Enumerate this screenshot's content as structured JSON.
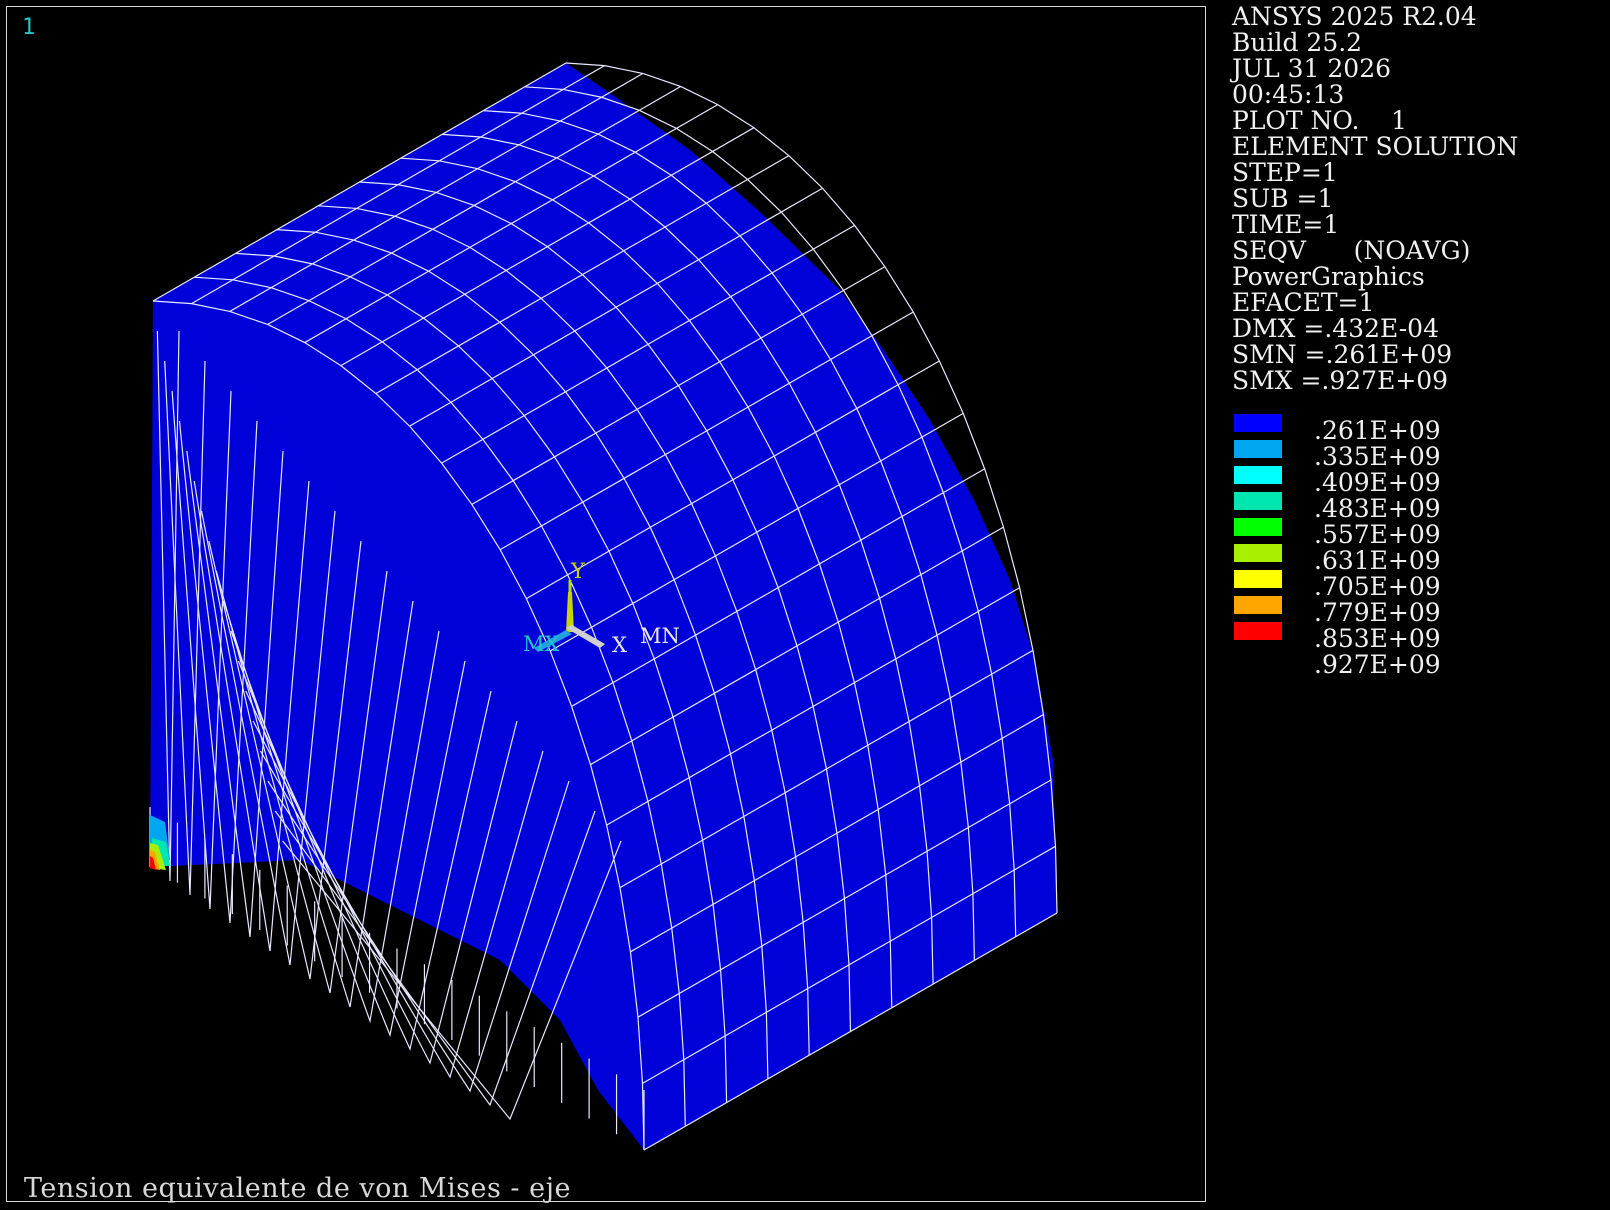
{
  "window_number": "1",
  "caption": "Tension equivalente de von Mises - eje",
  "info_lines": [
    "ANSYS 2025 R2.04",
    "Build 25.2",
    "JUL 31 2026",
    "00:45:13",
    "PLOT NO.    1",
    "ELEMENT SOLUTION",
    "STEP=1",
    "SUB =1",
    "TIME=1",
    "SEQV      (NOAVG)",
    "PowerGraphics",
    "EFACET=1",
    "DMX =.432E-04",
    "SMN =.261E+09",
    "SMX =.927E+09"
  ],
  "legend": [
    {
      "label": ".261E+09",
      "color": "#0000ff"
    },
    {
      "label": ".335E+09",
      "color": "#00a6f0"
    },
    {
      "label": ".409E+09",
      "color": "#00ffff"
    },
    {
      "label": ".483E+09",
      "color": "#00e6b0"
    },
    {
      "label": ".557E+09",
      "color": "#00ff00"
    },
    {
      "label": ".631E+09",
      "color": "#a6f000"
    },
    {
      "label": ".705E+09",
      "color": "#ffff00"
    },
    {
      "label": ".779E+09",
      "color": "#ffa600"
    },
    {
      "label": ".853E+09",
      "color": "#ff0000"
    },
    {
      "label": ".927E+09",
      "color": ""
    }
  ],
  "triad": {
    "y_label": "Y",
    "x_label": "X",
    "min_label": "MN",
    "max_label": "MX"
  },
  "colors": {
    "mesh_face": "#0000d8",
    "mesh_face_side": "#0000cc",
    "mesh_lines": "#e8e8ff",
    "text": "#f0f0f0"
  }
}
